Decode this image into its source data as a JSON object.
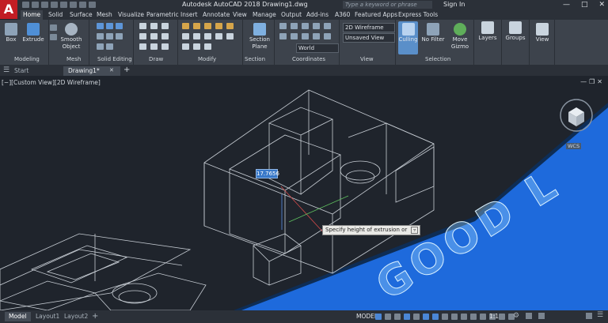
{
  "app": {
    "title": "Autodesk AutoCAD 2018    Drawing1.dwg",
    "search_placeholder": "Type a keyword or phrase",
    "signin": "Sign In",
    "logo": "A"
  },
  "ribbon_tabs": [
    "Home",
    "Solid",
    "Surface",
    "Mesh",
    "Visualize",
    "Parametric",
    "Insert",
    "Annotate",
    "View",
    "Manage",
    "Output",
    "Add-ins",
    "A360",
    "Featured Apps",
    "Express Tools"
  ],
  "ribbon": {
    "buttons": {
      "box": "Box",
      "extrude": "Extrude",
      "smooth_object": "Smooth Object",
      "section_plane": "Section Plane",
      "culling": "Culling",
      "no_filter": "No Filter",
      "move_gizmo": "Move Gizmo",
      "layers": "Layers",
      "groups": "Groups",
      "view": "View"
    },
    "dropdowns": {
      "visual_style": "2D Wireframe",
      "saved_view": "Unsaved View",
      "ucs": "World"
    },
    "panels": [
      "Modeling",
      "Mesh",
      "Solid Editing",
      "Draw",
      "Modify",
      "Section",
      "Coordinates",
      "View",
      "Selection"
    ]
  },
  "doc_tabs": [
    "Start",
    "Drawing1*"
  ],
  "viewport": {
    "label": "[−][Custom View][2D Wireframe]",
    "dynamic_input": "17.7656",
    "prompt": "Specify height of extrusion or",
    "wcs": "WCS",
    "text_on_plane": "GOOD L"
  },
  "status": {
    "layout_tabs": [
      "Model",
      "Layout1",
      "Layout2"
    ],
    "model": "MODEL",
    "scale": "1:1"
  },
  "colors": {
    "accent": "#3878c8",
    "logo_red": "#c21d24",
    "plane_blue": "#1f6fe6"
  }
}
